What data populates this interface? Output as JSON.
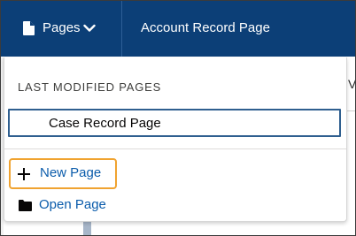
{
  "header": {
    "pages_menu_label": "Pages",
    "record_title": "Account Record Page",
    "background_color": "#0c3f77",
    "icons": {
      "page": "page-icon",
      "chevron": "chevron-down-icon"
    }
  },
  "dropdown": {
    "section_heading": "LAST MODIFIED PAGES",
    "recent_pages": [
      {
        "label": "Case Record Page"
      }
    ],
    "actions": {
      "new_page_label": "New Page",
      "open_page_label": "Open Page"
    },
    "highlight_color": "#f0a330",
    "link_color": "#0b5cab",
    "icons": {
      "new_page": "plus-icon",
      "open_page": "folder-icon"
    }
  },
  "background": {
    "partial_letter": "V"
  }
}
